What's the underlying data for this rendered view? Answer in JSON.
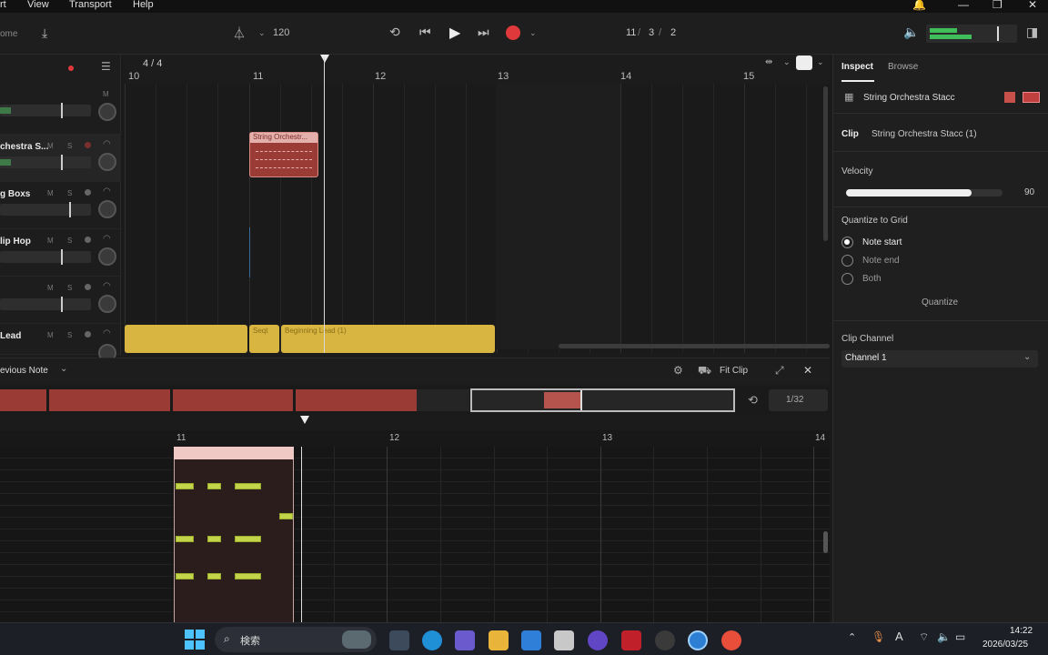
{
  "menu": {
    "items": [
      "rt",
      "View",
      "Transport",
      "Help"
    ]
  },
  "transport": {
    "left_label": "ome",
    "tempo": "120",
    "position": [
      "11",
      "3",
      "2"
    ]
  },
  "arrangement": {
    "time_signature": "4 / 4",
    "ruler": [
      "10",
      "11",
      "12",
      "13",
      "14",
      "15"
    ],
    "tracks": [
      {
        "name": "",
        "btns": [
          "M",
          ""
        ]
      },
      {
        "name": "chestra S...",
        "btns": [
          "M",
          "S",
          ""
        ]
      },
      {
        "name": "g Boxs",
        "btns": [
          "M",
          "S",
          ""
        ]
      },
      {
        "name": "lip Hop",
        "btns": [
          "M",
          "S",
          ""
        ]
      },
      {
        "name": "",
        "btns": [
          "M",
          "S",
          ""
        ]
      },
      {
        "name": " Lead",
        "btns": [
          "M",
          "S",
          ""
        ]
      }
    ],
    "clips": {
      "string_clip": "String Orchestr...",
      "lead_clip_1": "Seqt",
      "lead_clip_2": "Beginning Lead (1)"
    }
  },
  "inspector": {
    "tabs": [
      "Inspect",
      "Browse"
    ],
    "track_name": "String Orchestra Stacc",
    "clip_label": "Clip",
    "clip_name": "String Orchestra Stacc (1)",
    "velocity_label": "Velocity",
    "velocity_value": "90",
    "velocity_fraction": 0.8,
    "quantize_label": "Quantize to Grid",
    "quantize_options": [
      "Note start",
      "Note end",
      "Both"
    ],
    "quantize_selected": "Note start",
    "quantize_button": "Quantize",
    "clip_channel_label": "Clip Channel",
    "clip_channel_value": "Channel 1"
  },
  "editor": {
    "mode": "evious Note",
    "fit_clip": "Fit Clip",
    "grid": "1/32",
    "ruler": [
      "11",
      "12",
      "13",
      "14"
    ]
  },
  "taskbar": {
    "search_placeholder": "検索",
    "time": "14:22",
    "date": "2026/03/25"
  },
  "colors": {
    "accent_red": "#a8403c",
    "clip_red": "#9a3b36",
    "lead_clip": "#d8b440",
    "note_green": "#c4d44a",
    "record": "#e0393c",
    "meter_green": "#3fbf5a"
  }
}
